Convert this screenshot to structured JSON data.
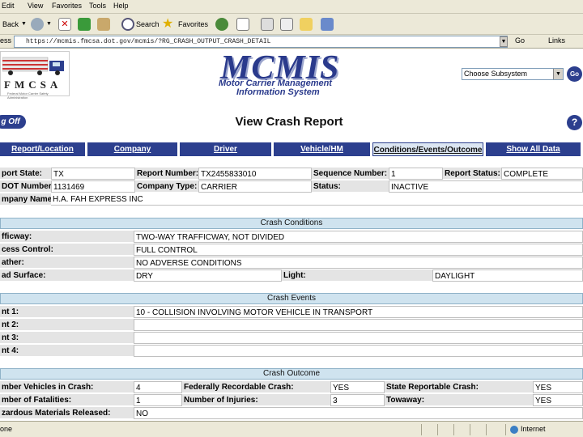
{
  "browser": {
    "menu": [
      "Edit",
      "View",
      "Favorites",
      "Tools",
      "Help"
    ],
    "toolbar": {
      "back": "Back",
      "search": "Search",
      "favorites": "Favorites"
    },
    "address_label": "ess",
    "address_url": "https://mcmis.fmcsa.dot.gov/mcmis/?RG_CRASH_OUTPUT_CRASH_DETAIL",
    "go_label": "Go",
    "links_label": "Links",
    "status_text": "one",
    "zone_text": "Internet"
  },
  "header": {
    "logo_text": "FMCSA",
    "logo_subtext": "Federal Motor Carrier Safety Administration",
    "app_title": "MCMIS",
    "app_subtitle_1": "Motor Carrier Management",
    "app_subtitle_2": "Information System",
    "subsystem_select": "Choose Subsystem",
    "go_button": "Go"
  },
  "page": {
    "logoff_label": "g Off",
    "title": "View Crash Report",
    "help_label": "?"
  },
  "tabs": [
    {
      "label": "Report/Location"
    },
    {
      "label": "Company"
    },
    {
      "label": "Driver"
    },
    {
      "label": "Vehicle/HM"
    },
    {
      "label": "Conditions/Events/Outcome"
    },
    {
      "label": "Show All Data"
    }
  ],
  "report": {
    "state_label": "port State:",
    "state_value": "TX",
    "report_number_label": "Report Number:",
    "report_number_value": "TX2455833010",
    "sequence_label": "Sequence Number:",
    "sequence_value": "1",
    "report_status_label": "Report Status:",
    "report_status_value": "COMPLETE",
    "usdot_label": "DOT Number:",
    "usdot_value": "1131469",
    "company_type_label": "Company Type:",
    "company_type_value": "CARRIER",
    "status_label": "Status:",
    "status_value": "INACTIVE",
    "company_name_label": "mpany Name:",
    "company_name_value": "H.A. FAH EXPRESS INC"
  },
  "conditions": {
    "header": "Crash Conditions",
    "trafficway_label": "fficway:",
    "trafficway_value": "TWO-WAY TRAFFICWAY, NOT DIVIDED",
    "access_label": "cess Control:",
    "access_value": "FULL CONTROL",
    "weather_label": "ather:",
    "weather_value": "NO ADVERSE CONDITIONS",
    "road_label": "ad Surface:",
    "road_value": "DRY",
    "light_label": "Light:",
    "light_value": "DAYLIGHT"
  },
  "events": {
    "header": "Crash Events",
    "rows": [
      {
        "label": "nt 1:",
        "value": "10 - COLLISION INVOLVING MOTOR VEHICLE IN TRANSPORT"
      },
      {
        "label": "nt 2:",
        "value": ""
      },
      {
        "label": "nt 3:",
        "value": ""
      },
      {
        "label": "nt 4:",
        "value": ""
      }
    ]
  },
  "outcome": {
    "header": "Crash Outcome",
    "vehicles_label": "mber Vehicles in Crash:",
    "vehicles_value": "4",
    "fed_recordable_label": "Federally Recordable Crash:",
    "fed_recordable_value": "YES",
    "state_reportable_label": "State Reportable Crash:",
    "state_reportable_value": "YES",
    "fatalities_label": "mber of Fatalities:",
    "fatalities_value": "1",
    "injuries_label": "Number of Injuries:",
    "injuries_value": "3",
    "towaway_label": "Towaway:",
    "towaway_value": "YES",
    "hazmat_label": "zardous Materials Released:",
    "hazmat_value": "NO"
  },
  "colors": {
    "navy": "#2c3f8e",
    "section_header_bg": "#cfe3ef",
    "label_bg": "#e4e4e4"
  }
}
